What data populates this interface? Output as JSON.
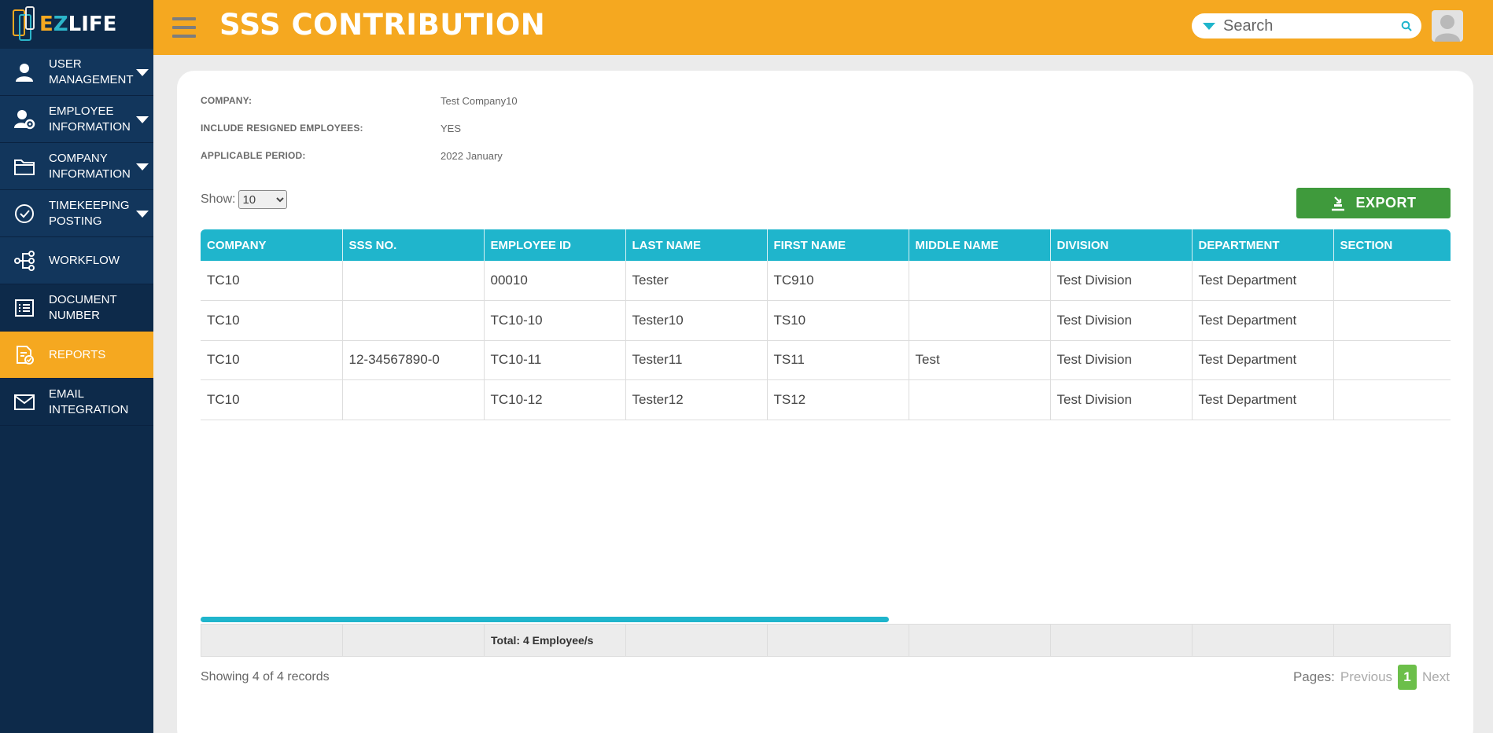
{
  "app": {
    "logo_e": "E",
    "logo_z": "Z",
    "logo_rest": "LIFE"
  },
  "header": {
    "title": "SSS CONTRIBUTION",
    "search_placeholder": "Search"
  },
  "sidebar": {
    "items": [
      {
        "label": "USER MANAGEMENT",
        "icon": "user-icon",
        "has_caret": true
      },
      {
        "label": "EMPLOYEE INFORMATION",
        "icon": "employee-settings-icon",
        "has_caret": true
      },
      {
        "label": "COMPANY INFORMATION",
        "icon": "folder-icon",
        "has_caret": true
      },
      {
        "label": "TIMEKEEPING POSTING",
        "icon": "check-circle-icon",
        "has_caret": true
      },
      {
        "label": "WORKFLOW",
        "icon": "workflow-icon",
        "has_caret": false
      },
      {
        "label": "DOCUMENT NUMBER",
        "icon": "document-list-icon",
        "has_caret": false
      },
      {
        "label": "REPORTS",
        "icon": "report-icon",
        "has_caret": false,
        "active": true
      },
      {
        "label": "EMAIL INTEGRATION",
        "icon": "mail-icon",
        "has_caret": false
      }
    ]
  },
  "filters": {
    "company_label": "COMPANY:",
    "company_value": "Test Company10",
    "resigned_label": "INCLUDE RESIGNED EMPLOYEES:",
    "resigned_value": "YES",
    "period_label": "APPLICABLE PERIOD:",
    "period_value": "2022 January"
  },
  "show": {
    "label": "Show:",
    "selected": "10"
  },
  "export_label": "EXPORT",
  "table": {
    "headers": [
      "COMPANY",
      "SSS NO.",
      "EMPLOYEE ID",
      "LAST NAME",
      "FIRST NAME",
      "MIDDLE NAME",
      "DIVISION",
      "DEPARTMENT",
      "SECTION"
    ],
    "rows": [
      [
        "TC10",
        "",
        "00010",
        "Tester",
        "TC910",
        "",
        "Test Division",
        "Test Department",
        ""
      ],
      [
        "TC10",
        "",
        "TC10-10",
        "Tester10",
        "TS10",
        "",
        "Test Division",
        "Test Department",
        ""
      ],
      [
        "TC10",
        "12-34567890-0",
        "TC10-11",
        "Tester11",
        "TS11",
        "Test",
        "Test Division",
        "Test Department",
        ""
      ],
      [
        "TC10",
        "",
        "TC10-12",
        "Tester12",
        "TS12",
        "",
        "Test Division",
        "Test Department",
        ""
      ]
    ],
    "total": "Total: 4 Employee/s"
  },
  "footer": {
    "showing": "Showing 4 of 4 records",
    "pages_label": "Pages:",
    "prev": "Previous",
    "page": "1",
    "next": "Next"
  },
  "colors": {
    "header": "#f5a820",
    "sidebar": "#0d2a4a",
    "table_header": "#1fb5cc",
    "export": "#3f9a3c"
  }
}
